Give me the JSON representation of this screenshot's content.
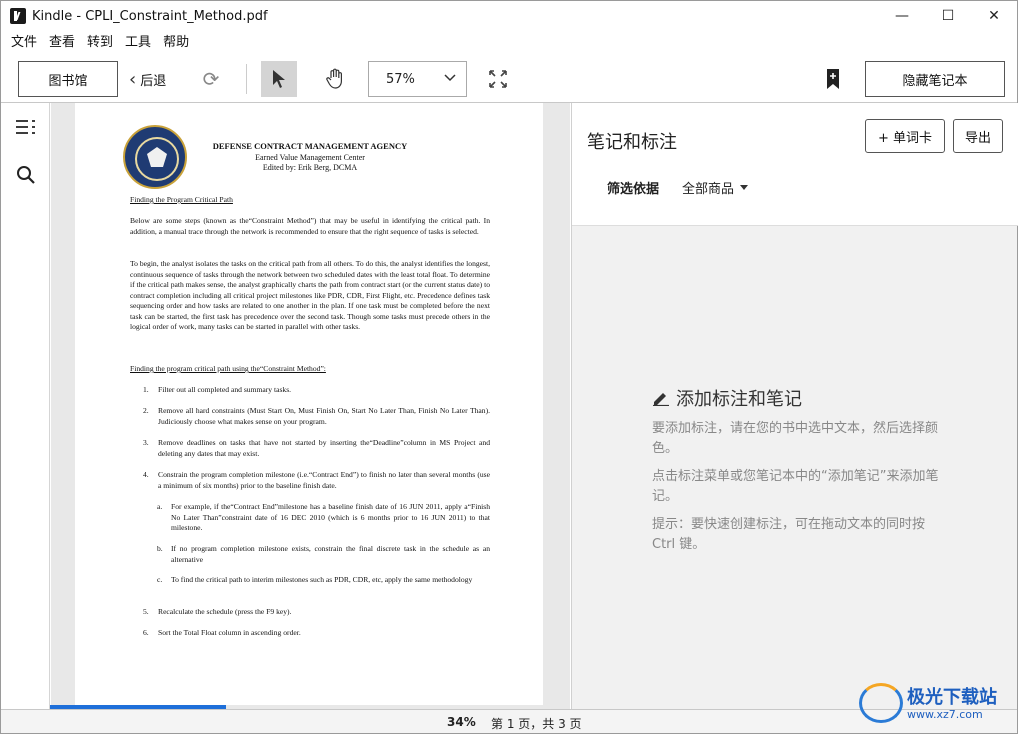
{
  "window": {
    "title": "Kindle - CPLI_Constraint_Method.pdf",
    "minimize": "—",
    "maximize": "☐",
    "close": "✕"
  },
  "menu": [
    "文件",
    "查看",
    "转到",
    "工具",
    "帮助"
  ],
  "toolbar": {
    "library_label": "图书馆",
    "back_label": "后退",
    "zoom_value": "57%",
    "hide_notebook_label": "隐藏笔记本"
  },
  "document": {
    "agency": "DEFENSE CONTRACT MANAGEMENT AGENCY",
    "center": "Earned Value Management Center",
    "editor": "Edited by: Erik Berg, DCMA",
    "heading1": "Finding the Program Critical Path",
    "para1": "Below are some steps (known as the“Constraint Method”) that may be useful in identifying the critical path. In addition, a manual trace through the network is recommended to ensure that the right sequence of tasks is selected.",
    "para2": "To begin, the analyst isolates the tasks on the critical path from all others. To do this, the analyst identifies the longest, continuous sequence of tasks through the network between two scheduled dates with the least total float. To determine if the critical path makes sense, the analyst graphically charts the path from contract start (or the current status date) to contract completion including all critical project milestones like PDR, CDR, First Flight, etc. Precedence defines task sequencing order and how tasks are related to one another in the plan. If one task must be completed before the next task can be started, the first task has precedence over the second task. Though some tasks must precede others in the logical order of work, many tasks can be started in parallel with other tasks.",
    "heading2": "Finding the program critical path using the“Constraint Method”:",
    "steps": [
      {
        "num": "1.",
        "text": "Filter out all completed and summary tasks."
      },
      {
        "num": "2.",
        "text": "Remove all hard constraints (Must Start On, Must Finish On, Start No Later Than, Finish No Later Than).  Judiciously choose what makes sense on your program."
      },
      {
        "num": "3.",
        "text": "Remove deadlines on tasks that have not started by inserting the“Deadline”column in MS Project and deleting any dates that may exist."
      },
      {
        "num": "4.",
        "text": "Constrain the program completion milestone (i.e.“Contract End”) to finish no later than several months (use a minimum of six months) prior to the baseline finish date."
      },
      {
        "num": "5.",
        "text": "Recalculate the schedule (press the F9 key)."
      },
      {
        "num": "6.",
        "text": "Sort the Total Float column in ascending order."
      }
    ],
    "substeps": [
      {
        "num": "a.",
        "text": "For example, if the“Contract End”milestone has a baseline finish date of 16 JUN 2011, apply a“Finish No Later Than”constraint date of 16 DEC 2010 (which is 6 months prior to 16 JUN 2011) to that milestone."
      },
      {
        "num": "b.",
        "text": "If no program completion milestone exists, constrain the final discrete task in the schedule as an alternative"
      },
      {
        "num": "c.",
        "text": "To find the critical path to interim milestones such as PDR, CDR, etc, apply the same methodology"
      }
    ]
  },
  "notes": {
    "title": "笔记和标注",
    "flashcard_label": "+ 单词卡",
    "export_label": "导出",
    "filter_label": "筛选依据",
    "filter_value": "全部商品",
    "empty_title": "添加标注和笔记",
    "empty_p1": "要添加标注，请在您的书中选中文本，然后选择颜色。",
    "empty_p2": "点击标注菜单或您笔记本中的“添加笔记”来添加笔记。",
    "empty_p3": "提示：要快速创建标注，可在拖动文本的同时按 Ctrl 键。"
  },
  "status": {
    "percent": "34%",
    "page": "第 1 页，共 3 页"
  },
  "reading_progress": 0.34,
  "watermark": {
    "name": "极光下载站",
    "url": "www.xz7.com"
  },
  "colors": {
    "accent": "#1e6fd9",
    "selected_tool": "#d4d4d4"
  }
}
